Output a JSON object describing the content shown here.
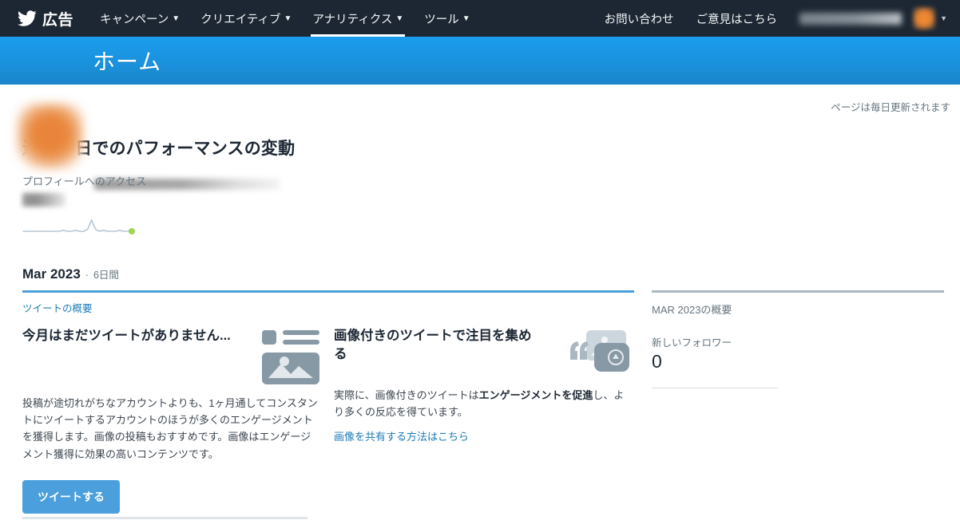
{
  "nav": {
    "brand_icon": "twitter-bird-icon",
    "brand_label": "広告",
    "items": [
      {
        "label": "キャンペーン",
        "caret": "❯",
        "active": false
      },
      {
        "label": "クリエイティブ",
        "caret": "❯",
        "active": false
      },
      {
        "label": "アナリティクス",
        "caret": "❯",
        "active": true
      },
      {
        "label": "ツール",
        "caret": "❯",
        "active": false
      }
    ],
    "right_links": [
      "お問い合わせ",
      "ご意見はこちら"
    ],
    "account_name_redacted": true,
    "avatar_icon": "user-avatar",
    "avatar_caret": "❯"
  },
  "banner": {
    "title": "ホーム",
    "profile_avatar_icon": "profile-avatar",
    "profile_name_redacted": true,
    "update_note": "ページは毎日更新されます"
  },
  "performance": {
    "title": "過去28日でのパフォーマンスの変動",
    "metric_label": "プロフィールへのアクセス",
    "metric_value_redacted": true
  },
  "period": {
    "month": "Mar 2023",
    "separator": "·",
    "days": "6日間"
  },
  "tweet_section": {
    "link_label": "ツイートの概要",
    "cards": [
      {
        "title": "今月はまだツイートがありません...",
        "icon": "tweet-composer-icon",
        "body": "投稿が途切れがちなアカウントよりも、1ヶ月通してコンスタントにツイートするアカウントのほうが多くのエンゲージメントを獲得します。画像の投稿もおすすめです。画像はエンゲージメント獲得に効果の高いコンテンツです。",
        "button_label": "ツイートする"
      },
      {
        "title": "画像付きのツイートで注目を集める",
        "icon": "image-media-icon",
        "body_prefix": "実際に、画像付きのツイートは",
        "body_bold": "エンゲージメントを促進",
        "body_suffix": "し、より多くの反応を得ています。",
        "link_label": "画像を共有する方法はこちら"
      }
    ]
  },
  "summary": {
    "header": "MAR 2023の概要",
    "stats": [
      {
        "label": "新しいフォロワー",
        "value": "0"
      }
    ]
  },
  "chart_data": {
    "type": "line",
    "title": "プロフィールへのアクセス",
    "xlabel": "",
    "ylabel": "",
    "grid": false,
    "legend": null,
    "x": [
      0,
      1,
      2,
      3,
      4,
      5,
      6,
      7,
      8,
      9,
      10,
      11,
      12,
      13,
      14,
      15,
      16,
      17,
      18,
      19,
      20,
      21,
      22,
      23,
      24,
      25,
      26,
      27
    ],
    "series": [
      {
        "name": "プロフィールへのアクセス",
        "values": [
          0,
          0,
          0,
          0,
          0,
          0,
          0,
          0,
          0,
          0,
          0.5,
          0,
          0,
          0.5,
          0,
          0,
          1,
          6,
          1,
          0,
          0.5,
          0,
          0,
          0,
          0.5,
          0,
          0,
          0
        ]
      }
    ],
    "ylim": [
      0,
      6
    ],
    "line_color": "#b8c6d2",
    "endpoint_color": "#9ed64f",
    "endpoint": {
      "x": 27,
      "y": 0
    }
  },
  "colors": {
    "nav_bg": "#1c2733",
    "banner_top": "#1b9ced",
    "banner_bottom": "#1a85c9",
    "accent_blue": "#4a9fdc",
    "link_blue": "#1b7bb9",
    "rule_grey": "#aab8c2",
    "text_dark": "#1c2733",
    "text_muted": "#66757f",
    "icon_grey": "#8899a6",
    "green_dot": "#9ed64f"
  }
}
